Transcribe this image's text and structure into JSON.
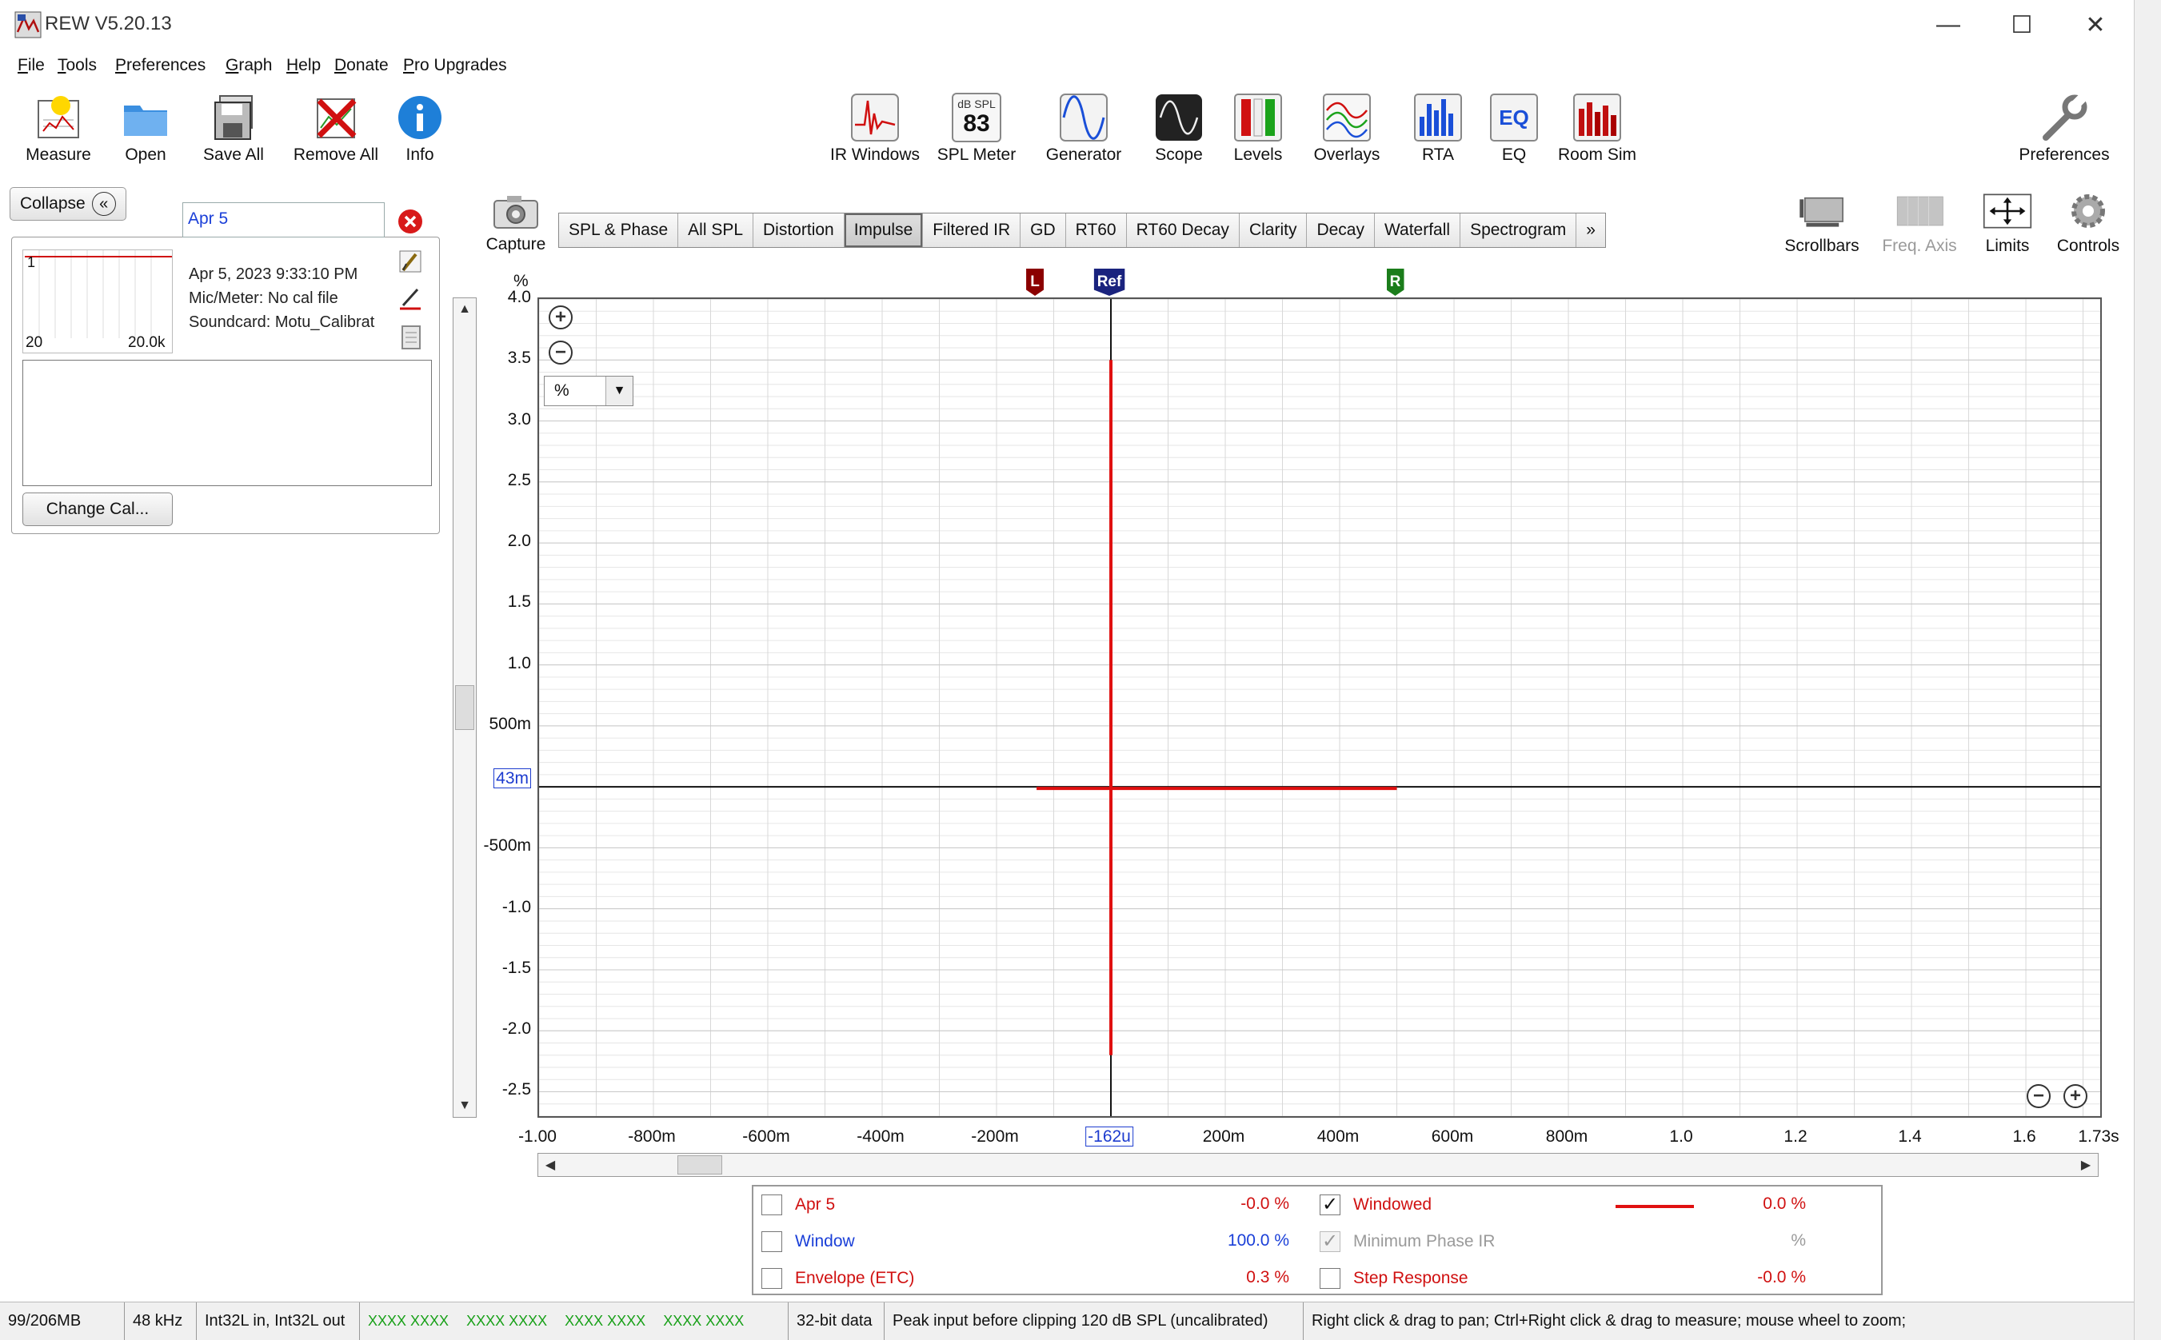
{
  "window": {
    "title": "REW V5.20.13",
    "minimize": "—",
    "maximize": "☐",
    "close": "✕"
  },
  "menu": [
    "File",
    "Tools",
    "Preferences",
    "Graph",
    "Help",
    "Donate",
    "Pro Upgrades"
  ],
  "toolbar_left": [
    {
      "label": "Measure",
      "icon": "measure-icon"
    },
    {
      "label": "Open",
      "icon": "folder-icon"
    },
    {
      "label": "Save All",
      "icon": "save-icon"
    },
    {
      "label": "Remove All",
      "icon": "remove-icon"
    },
    {
      "label": "Info",
      "icon": "info-icon"
    }
  ],
  "toolbar_center": [
    {
      "label": "IR Windows",
      "icon": "ir-windows-icon"
    },
    {
      "label": "SPL Meter",
      "icon": "spl-meter-icon",
      "icon_top": "dB SPL",
      "icon_value": "83"
    },
    {
      "label": "Generator",
      "icon": "generator-icon"
    },
    {
      "label": "Scope",
      "icon": "scope-icon"
    },
    {
      "label": "Levels",
      "icon": "levels-icon"
    },
    {
      "label": "Overlays",
      "icon": "overlays-icon"
    },
    {
      "label": "RTA",
      "icon": "rta-icon"
    },
    {
      "label": "EQ",
      "icon": "eq-icon"
    },
    {
      "label": "Room Sim",
      "icon": "room-sim-icon"
    }
  ],
  "toolbar_right": {
    "label": "Preferences",
    "icon": "wrench-icon"
  },
  "graph_controls": [
    {
      "label": "Scrollbars",
      "icon": "scrollbars-icon",
      "enabled": true
    },
    {
      "label": "Freq. Axis",
      "icon": "freq-axis-icon",
      "enabled": false
    },
    {
      "label": "Limits",
      "icon": "limits-icon",
      "enabled": true
    },
    {
      "label": "Controls",
      "icon": "gear-icon",
      "enabled": true
    }
  ],
  "capture": {
    "label": "Capture"
  },
  "left_panel": {
    "collapse_label": "Collapse",
    "measurement_name": "Apr 5",
    "thumb_index": "1",
    "thumb_x_min": "20",
    "thumb_x_max": "20.0k",
    "date": "Apr 5, 2023 9:33:10 PM",
    "mic": "Mic/Meter: No cal file",
    "soundcard": "Soundcard: Motu_Calibrat",
    "change_cal": "Change Cal..."
  },
  "tabs": [
    "SPL & Phase",
    "All SPL",
    "Distortion",
    "Impulse",
    "Filtered IR",
    "GD",
    "RT60",
    "RT60 Decay",
    "Clarity",
    "Decay",
    "Waterfall",
    "Spectrogram",
    "»"
  ],
  "active_tab": "Impulse",
  "chart_data": {
    "type": "line",
    "ylabel": "%",
    "y_ticks": [
      "4.0",
      "3.5",
      "3.0",
      "2.5",
      "2.0",
      "1.5",
      "1.0",
      "500m",
      "-500m",
      "-1.0",
      "-1.5",
      "-2.0",
      "-2.5"
    ],
    "y_cursor": "43m",
    "x_ticks": [
      "-1.00",
      "-800m",
      "-600m",
      "-400m",
      "-200m",
      "-162u",
      "200m",
      "400m",
      "600m",
      "800m",
      "1.0",
      "1.2",
      "1.4",
      "1.6",
      "1.73s"
    ],
    "x_cursor": "-162u",
    "xlim": [
      -1.0,
      1.73
    ],
    "ylim": [
      -2.7,
      4.0
    ],
    "markers": [
      {
        "label": "L",
        "x": -0.13,
        "color": "#8b0000"
      },
      {
        "label": "Ref",
        "x": 0.0,
        "color": "#1a237e"
      },
      {
        "label": "R",
        "x": 0.5,
        "color": "#1b7d1b"
      }
    ],
    "series": [
      {
        "name": "Windowed",
        "color": "#e01010",
        "impulse": {
          "x": 0.0,
          "top": 3.5,
          "bottom": -2.2
        },
        "window_span": [
          -0.13,
          0.5
        ]
      }
    ],
    "unit": "%"
  },
  "legend": {
    "rows": [
      {
        "left": {
          "name": "Apr 5",
          "value": "-0.0 %",
          "checked": false,
          "color": "#d01010"
        },
        "right": {
          "name": "Windowed",
          "value": "0.0 %",
          "checked": true,
          "color": "#d01010",
          "line": true
        }
      },
      {
        "left": {
          "name": "Window",
          "value": "100.0 %",
          "checked": false,
          "color": "#1a3fd8"
        },
        "right": {
          "name": "Minimum Phase IR",
          "value": "%",
          "checked": true,
          "color": "#999999",
          "disabled": true
        }
      },
      {
        "left": {
          "name": "Envelope (ETC)",
          "value": "0.3 %",
          "checked": false,
          "color": "#d01010"
        },
        "right": {
          "name": "Step Response",
          "value": "-0.0 %",
          "checked": false,
          "color": "#d01010"
        }
      }
    ]
  },
  "status": {
    "memory": "99/206MB",
    "rate": "48 kHz",
    "io": "Int32L in, Int32L out",
    "meters": [
      "XXXX XXXX",
      "XXXX XXXX",
      "XXXX XXXX",
      "XXXX XXXX"
    ],
    "bits": "32-bit data",
    "peak": "Peak input before clipping 120 dB SPL (uncalibrated)",
    "hint": "Right click & drag to pan; Ctrl+Right click & drag to measure; mouse wheel to zoom;"
  }
}
